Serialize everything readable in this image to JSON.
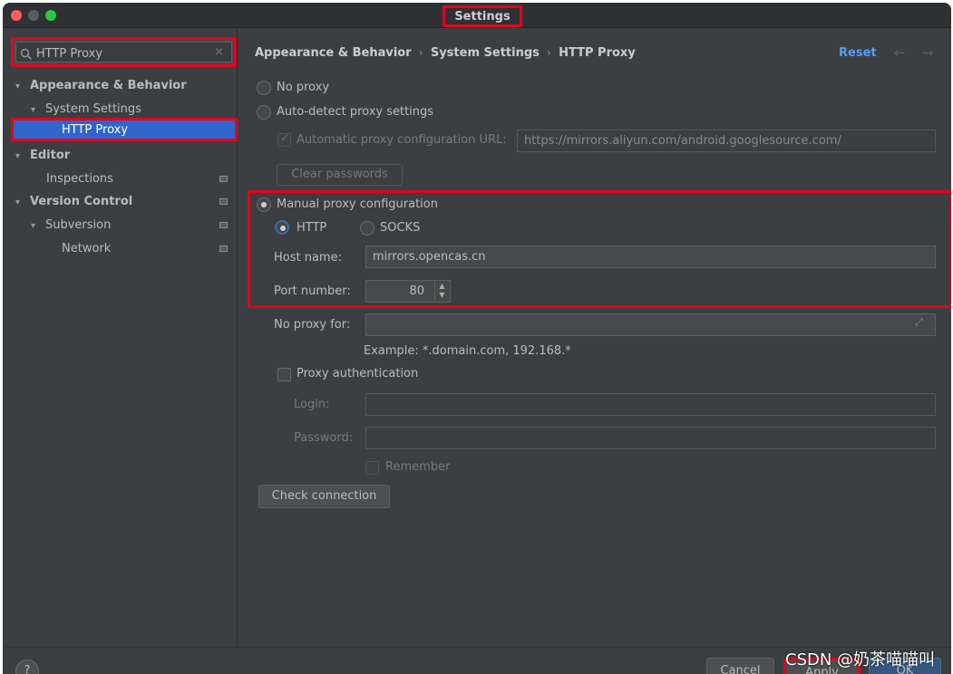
{
  "window": {
    "title": "Settings"
  },
  "search": {
    "value": "HTTP Proxy",
    "clear_icon": "×"
  },
  "tree": {
    "appearance": "Appearance & Behavior",
    "system_settings": "System Settings",
    "http_proxy": "HTTP Proxy",
    "editor": "Editor",
    "inspections": "Inspections",
    "version_control": "Version Control",
    "subversion": "Subversion",
    "network": "Network"
  },
  "breadcrumb": {
    "part1": "Appearance & Behavior",
    "part2": "System Settings",
    "part3": "HTTP Proxy",
    "separator": "›"
  },
  "header": {
    "reset_label": "Reset",
    "back_icon": "←",
    "forward_icon": "→"
  },
  "proxy": {
    "no_proxy": "No proxy",
    "auto_detect": "Auto-detect proxy settings",
    "auto_url_label": "Automatic proxy configuration URL:",
    "auto_url_value": "https://mirrors.aliyun.com/android.googlesource.com/",
    "clear_passwords": "Clear passwords",
    "manual": "Manual proxy configuration",
    "http": "HTTP",
    "socks": "SOCKS",
    "host_label": "Host name:",
    "host_value": "mirrors.opencas.cn",
    "port_label": "Port number:",
    "port_value": "80",
    "no_proxy_for_label": "No proxy for:",
    "no_proxy_for_value": "",
    "example": "Example: *.domain.com, 192.168.*",
    "auth_label": "Proxy authentication",
    "login_label": "Login:",
    "login_value": "",
    "password_label": "Password:",
    "password_value": "",
    "remember": "Remember",
    "check_connection": "Check connection"
  },
  "footer": {
    "help": "?",
    "cancel": "Cancel",
    "apply": "Apply",
    "ok": "OK",
    "watermark": "CSDN @奶茶喵喵叫"
  }
}
